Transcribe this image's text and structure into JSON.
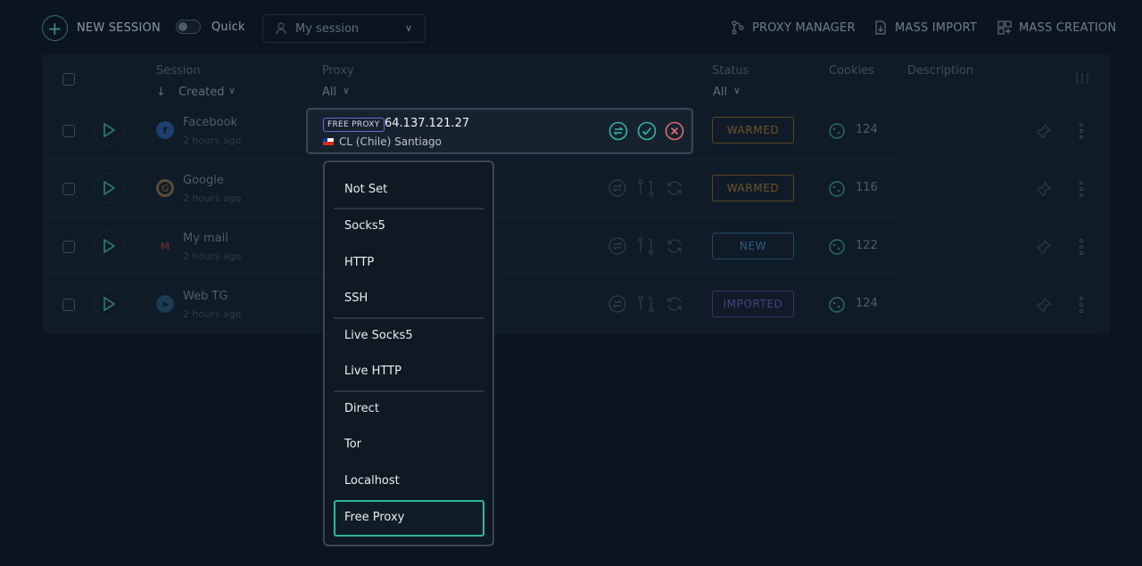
{
  "toolbar": {
    "new_session": "NEW SESSION",
    "quick": "Quick",
    "session_select": "My session",
    "proxy_manager": "PROXY MANAGER",
    "mass_import": "MASS IMPORT",
    "mass_creation": "MASS CREATION"
  },
  "table": {
    "headers": {
      "session": "Session",
      "session_sort": "Created",
      "proxy": "Proxy",
      "proxy_filter": "All",
      "status": "Status",
      "status_filter": "All",
      "cookies": "Cookies",
      "description": "Description"
    },
    "rows": [
      {
        "name": "Facebook",
        "time": "2 hours ago",
        "status": "WARMED",
        "cookies": "124"
      },
      {
        "name": "Google",
        "time": "2 hours ago",
        "status": "WARMED",
        "cookies": "116"
      },
      {
        "name": "My mail",
        "time": "2 hours ago",
        "status": "NEW",
        "cookies": "122"
      },
      {
        "name": "Web TG",
        "time": "2 hours ago",
        "status": "IMPORTED",
        "cookies": "124"
      }
    ]
  },
  "proxy_editor": {
    "badge": "FREE PROXY",
    "ip": "64.137.121.27",
    "location": "CL (Chile) Santiago"
  },
  "dropdown": {
    "items": [
      "Not Set",
      "Socks5",
      "HTTP",
      "SSH",
      "Live Socks5",
      "Live HTTP",
      "Direct",
      "Tor",
      "Localhost",
      "Free Proxy"
    ],
    "selected": "Free Proxy"
  },
  "colors": {
    "background": "#0b1520",
    "accent": "#2fb4a0",
    "status_warmed": "#a0702a",
    "status_new": "#2a6a9a",
    "status_imported": "#6a4ab0"
  }
}
